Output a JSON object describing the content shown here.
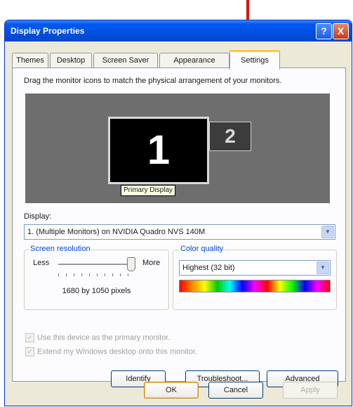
{
  "window": {
    "title": "Display Properties",
    "help_glyph": "?",
    "close_glyph": "X"
  },
  "tabs": [
    {
      "label": "Themes"
    },
    {
      "label": "Desktop"
    },
    {
      "label": "Screen Saver"
    },
    {
      "label": "Appearance"
    },
    {
      "label": "Settings"
    }
  ],
  "active_tab": "Settings",
  "settings": {
    "instruction": "Drag the monitor icons to match the physical arrangement of your monitors.",
    "monitor1_number": "1",
    "monitor2_number": "2",
    "primary_label": "Primary Display",
    "display_label": "Display:",
    "display_value": "1. (Multiple Monitors) on NVIDIA Quadro NVS 140M",
    "screen_resolution": {
      "legend": "Screen resolution",
      "less": "Less",
      "more": "More",
      "value_text": "1680 by 1050 pixels",
      "slider_level": 1.0
    },
    "color_quality": {
      "legend": "Color quality",
      "selected": "Highest (32 bit)"
    },
    "checkboxes": [
      {
        "label": "Use this device as the primary monitor.",
        "checked": true,
        "enabled": false
      },
      {
        "label": "Extend my Windows desktop onto this monitor.",
        "checked": true,
        "enabled": false
      }
    ],
    "buttons": {
      "identify": "Identify",
      "troubleshoot": "Troubleshoot...",
      "advanced": "Advanced"
    }
  },
  "footer": {
    "ok": "OK",
    "cancel": "Cancel",
    "apply": "Apply"
  },
  "colors": {
    "title_bar": "#0058ee",
    "accent_tab": "#ffc83c",
    "annotation_arrow": "#d9150c",
    "group_legend": "#0046d5"
  }
}
